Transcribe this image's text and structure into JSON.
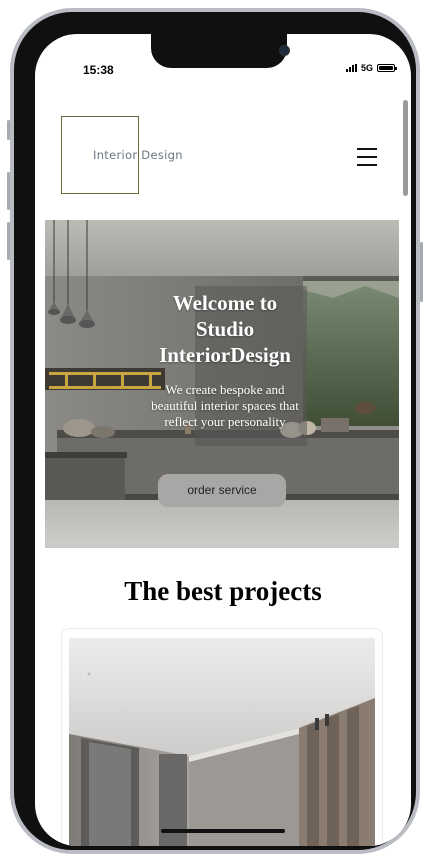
{
  "status_bar": {
    "time": "15:38",
    "network": "5G"
  },
  "header": {
    "logo_text": "Interior Design",
    "menu_icon": "hamburger-menu-icon"
  },
  "hero": {
    "title": "Welcome to Studio InteriorDesign",
    "subtitle": "We create bespoke and beautiful interior spaces that reflect your personality",
    "cta_label": "order service"
  },
  "projects": {
    "title": "The best projects"
  },
  "colors": {
    "frame": "#b9bcc3",
    "bezel": "#101010",
    "logo_border": "#6b6b3e",
    "cta_bg": "#a9a7a5"
  }
}
